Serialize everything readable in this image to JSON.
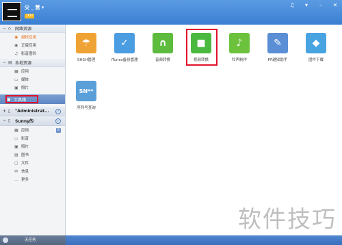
{
  "header": {
    "username": "尖 _ 慧 ▾",
    "badge": "1km",
    "controls": [
      "♫",
      "▾",
      "–",
      "✕"
    ]
  },
  "sidebar": {
    "network_section": "网络资源",
    "network_items": [
      {
        "label": "越狱应用",
        "icon": "app-icon"
      },
      {
        "label": "正版应用",
        "icon": "app-icon"
      },
      {
        "label": "影音图铃",
        "icon": "music-icon"
      }
    ],
    "local_section": "本地资源",
    "local_items": [
      {
        "label": "应用",
        "icon": "grid-icon"
      },
      {
        "label": "媒体",
        "icon": "media-icon"
      },
      {
        "label": "照片",
        "icon": "photo-icon"
      }
    ],
    "toolbox": "工具箱",
    "device1": "\"Administrat...",
    "device2": "Sunny的",
    "device2_items": [
      {
        "label": "应用",
        "badge": "8"
      },
      {
        "label": "影音"
      },
      {
        "label": "照片"
      },
      {
        "label": "图书"
      },
      {
        "label": "文件"
      },
      {
        "label": "信息"
      },
      {
        "label": "更多"
      }
    ]
  },
  "status": {
    "label": "无任务"
  },
  "tools": [
    {
      "label": "SHSH管理",
      "color": "#f0a335"
    },
    {
      "label": "iTunes备份管理",
      "color": "#4a9de0"
    },
    {
      "label": "音频转换",
      "color": "#5dbb3e"
    },
    {
      "label": "视频转换",
      "color": "#4bb940"
    },
    {
      "label": "铃声制作",
      "color": "#6cc23d"
    },
    {
      "label": "PP越狱助手",
      "color": "#5a8fd6"
    },
    {
      "label": "固件下载",
      "color": "#47a4e0"
    },
    {
      "label": "序列号查询",
      "color": "#5a9fd8"
    }
  ],
  "watermark": "软件技巧"
}
